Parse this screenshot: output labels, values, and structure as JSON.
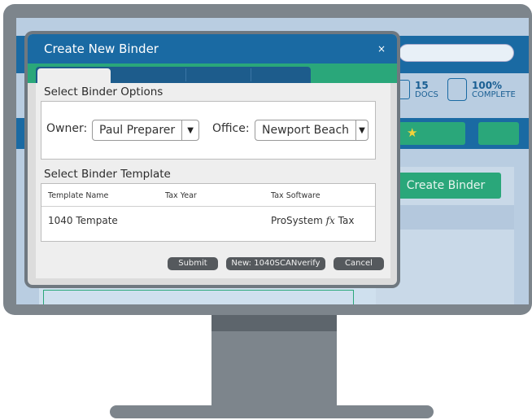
{
  "background_app": {
    "stats": [
      {
        "value": "15",
        "label": "DOCS",
        "icon": "document-icon"
      },
      {
        "value": "100%",
        "label": "COMPLETE",
        "icon": "clipboard-checklist-icon"
      }
    ],
    "nav_icon": "star-icon",
    "create_binder_label": "Create Binder"
  },
  "dialog": {
    "title": "Create New Binder",
    "close_label": "×",
    "options": {
      "section_title": "Select Binder Options",
      "owner_label": "Owner:",
      "owner_value": "Paul Preparer",
      "office_label": "Office:",
      "office_value": "Newport Beach"
    },
    "template": {
      "section_title": "Select Binder Template",
      "columns": [
        "Template Name",
        "Tax Year",
        "Tax Software"
      ],
      "rows": [
        {
          "name": "1040 Tempate",
          "year": "",
          "software_prefix": "ProSystem ",
          "software_fx": "fx",
          "software_suffix": " Tax"
        }
      ]
    },
    "buttons": {
      "submit": "Submit",
      "new": "New: 1040SCANverify",
      "cancel": "Cancel"
    }
  },
  "colors": {
    "brand_blue": "#1a6aa3",
    "accent_green": "#2aa77a",
    "monitor_gray": "#7d858c",
    "button_gray": "#55595d"
  }
}
